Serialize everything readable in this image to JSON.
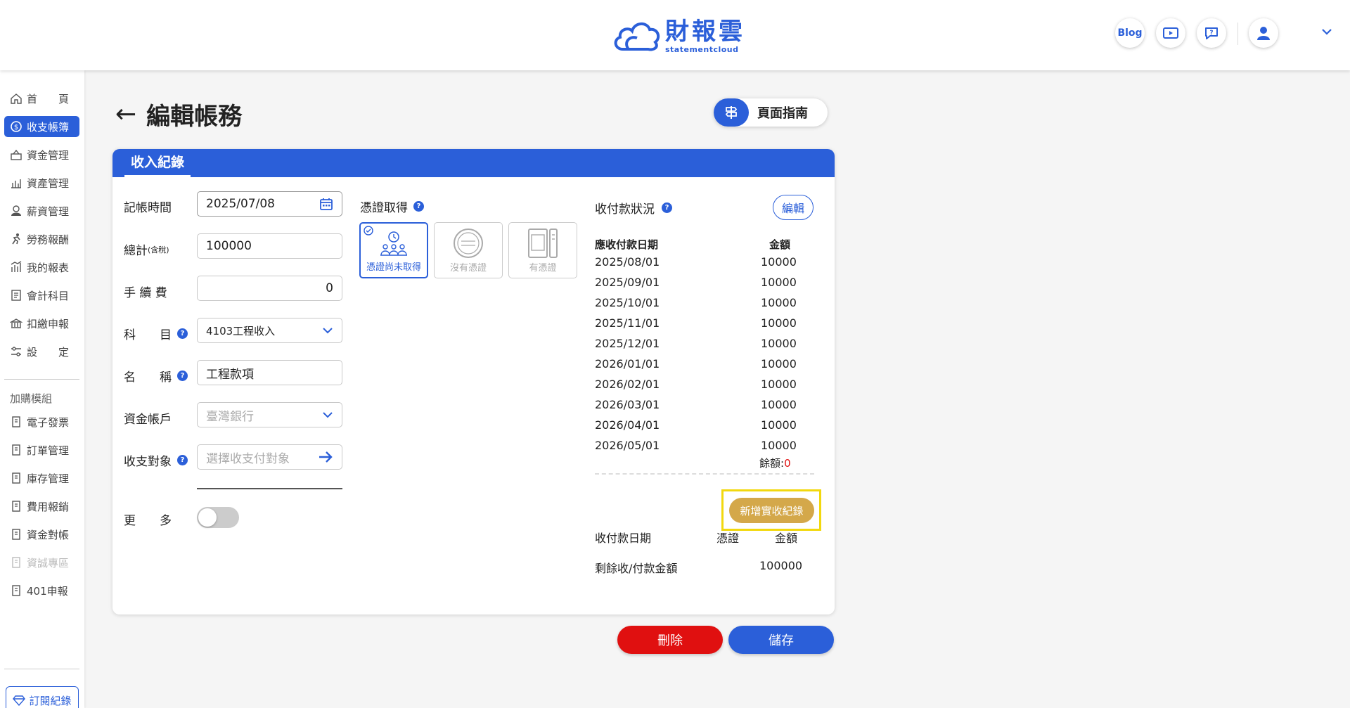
{
  "header": {
    "logo_text": "財報雲",
    "logo_sub": "statementcloud",
    "blog_label": "Blog",
    "icons": [
      "video-guide-icon",
      "help-chat-icon",
      "user-avatar-icon",
      "chevron-down-icon"
    ]
  },
  "sidebar": {
    "items": [
      {
        "label": "首　　頁",
        "icon": "home-icon"
      },
      {
        "label": "收支帳簿",
        "icon": "ledger-icon",
        "active": true
      },
      {
        "label": "資金管理",
        "icon": "fund-icon"
      },
      {
        "label": "資產管理",
        "icon": "asset-icon"
      },
      {
        "label": "薪資管理",
        "icon": "salary-icon"
      },
      {
        "label": "勞務報酬",
        "icon": "labor-icon"
      },
      {
        "label": "我的報表",
        "icon": "report-icon"
      },
      {
        "label": "會計科目",
        "icon": "account-icon"
      },
      {
        "label": "扣繳申報",
        "icon": "withholding-icon"
      },
      {
        "label": "設　　定",
        "icon": "settings-icon"
      }
    ],
    "addon_title": "加購模組",
    "addons": [
      {
        "label": "電子發票"
      },
      {
        "label": "訂單管理"
      },
      {
        "label": "庫存管理"
      },
      {
        "label": "費用報銷"
      },
      {
        "label": "資金對帳"
      },
      {
        "label": "資誠專區",
        "disabled": true
      },
      {
        "label": "401申報"
      }
    ],
    "subscription_label": "訂閱紀錄"
  },
  "page": {
    "back_arrow": "←",
    "title": "編輯帳務",
    "guide_label": "頁面指南"
  },
  "card": {
    "tab_label": "收入紀錄",
    "form": {
      "date_label": "記帳時間",
      "date_value": "2025/07/08",
      "total_label": "總計",
      "total_suffix": "(含稅)",
      "total_value": "100000",
      "fee_label": "手 續 費",
      "fee_value": "0",
      "subject_label": "科　　目",
      "subject_value": "4103工程收入",
      "name_label": "名　　稱",
      "name_value": "工程款項",
      "account_label": "資金帳戶",
      "account_placeholder": "臺灣銀行",
      "target_label": "收支對象",
      "target_placeholder": "選擇收支付對象",
      "more_label": "更　　多",
      "more_enabled": false
    },
    "certificate": {
      "title": "憑證取得",
      "options": [
        {
          "label": "憑證尚未取得",
          "selected": true
        },
        {
          "label": "沒有憑證",
          "selected": false
        },
        {
          "label": "有憑證",
          "selected": false
        }
      ]
    },
    "payment": {
      "title": "收付款狀況",
      "edit_label": "編輯",
      "schedule_headers": [
        "應收付款日期",
        "金額"
      ],
      "schedule": [
        {
          "date": "2025/08/01",
          "amount": "10000"
        },
        {
          "date": "2025/09/01",
          "amount": "10000"
        },
        {
          "date": "2025/10/01",
          "amount": "10000"
        },
        {
          "date": "2025/11/01",
          "amount": "10000"
        },
        {
          "date": "2025/12/01",
          "amount": "10000"
        },
        {
          "date": "2026/01/01",
          "amount": "10000"
        },
        {
          "date": "2026/02/01",
          "amount": "10000"
        },
        {
          "date": "2026/03/01",
          "amount": "10000"
        },
        {
          "date": "2026/04/01",
          "amount": "10000"
        },
        {
          "date": "2026/05/01",
          "amount": "10000"
        }
      ],
      "balance_label": "餘額:",
      "balance_value": "0",
      "add_actual_label": "新增實收紀錄",
      "actual_headers": [
        "收付款日期",
        "憑證",
        "金額"
      ],
      "remaining_label": "剩餘收/付款金額",
      "remaining_value": "100000"
    }
  },
  "actions": {
    "delete_label": "刪除",
    "save_label": "儲存"
  },
  "colors": {
    "primary": "#2b5fd9",
    "danger": "#e01010",
    "add_button": "#d4a84a",
    "highlight": "#f2d80e"
  }
}
